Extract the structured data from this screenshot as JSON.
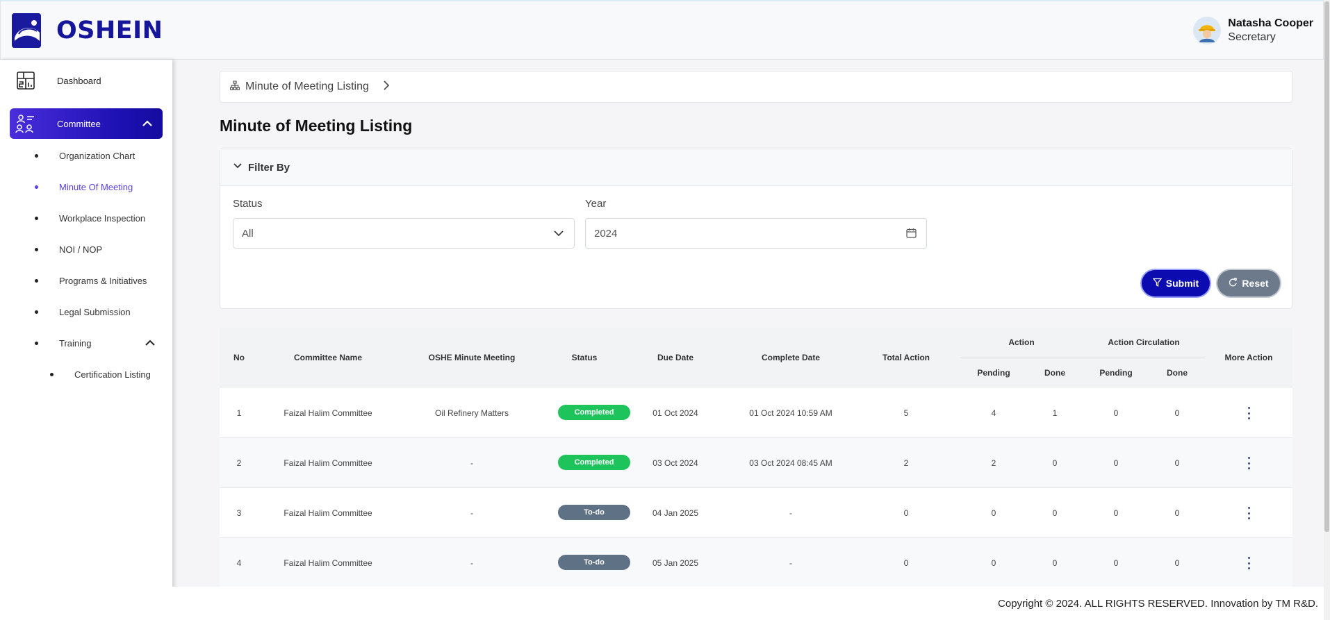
{
  "app": {
    "name": "OSHEIN"
  },
  "user": {
    "name": "Natasha Cooper",
    "role": "Secretary"
  },
  "sidebar": {
    "items": [
      {
        "label": "Dashboard",
        "icon": "dashboard-icon"
      },
      {
        "label": "Committee",
        "icon": "committee-icon",
        "active": true
      }
    ],
    "committee_sub": [
      {
        "label": "Organization Chart"
      },
      {
        "label": "Minute Of Meeting",
        "active": true
      },
      {
        "label": "Workplace Inspection"
      },
      {
        "label": "NOI / NOP"
      },
      {
        "label": "Programs & Initiatives"
      },
      {
        "label": "Legal Submission"
      },
      {
        "label": "Training"
      }
    ],
    "training_sub": [
      {
        "label": "Certification Listing"
      }
    ]
  },
  "breadcrumb": {
    "label": "Minute of Meeting Listing"
  },
  "page": {
    "title": "Minute of Meeting Listing"
  },
  "filter": {
    "title": "Filter By",
    "status_label": "Status",
    "status_value": "All",
    "year_label": "Year",
    "year_value": "2024",
    "submit_label": "Submit",
    "reset_label": "Reset"
  },
  "table": {
    "headers": {
      "no": "No",
      "committee": "Committee Name",
      "oshe": "OSHE Minute Meeting",
      "status": "Status",
      "due": "Due Date",
      "complete": "Complete Date",
      "total": "Total Action",
      "action_group": "Action",
      "action_circ_group": "Action Circulation",
      "pending": "Pending",
      "done": "Done",
      "more": "More Action"
    },
    "rows": [
      {
        "no": "1",
        "committee": "Faizal Halim Committee",
        "oshe": "Oil Refinery Matters",
        "status": "Completed",
        "due": "01 Oct 2024",
        "complete": "01 Oct 2024 10:59 AM",
        "total": "5",
        "pending": "4",
        "done": "1",
        "circ_pending": "0",
        "circ_done": "0"
      },
      {
        "no": "2",
        "committee": "Faizal Halim Committee",
        "oshe": "-",
        "status": "Completed",
        "due": "03 Oct 2024",
        "complete": "03 Oct 2024 08:45 AM",
        "total": "2",
        "pending": "2",
        "done": "0",
        "circ_pending": "0",
        "circ_done": "0"
      },
      {
        "no": "3",
        "committee": "Faizal Halim Committee",
        "oshe": "-",
        "status": "To-do",
        "due": "04 Jan 2025",
        "complete": "-",
        "total": "0",
        "pending": "0",
        "done": "0",
        "circ_pending": "0",
        "circ_done": "0"
      },
      {
        "no": "4",
        "committee": "Faizal Halim Committee",
        "oshe": "-",
        "status": "To-do",
        "due": "05 Jan 2025",
        "complete": "-",
        "total": "0",
        "pending": "0",
        "done": "0",
        "circ_pending": "0",
        "circ_done": "0"
      }
    ]
  },
  "footer": {
    "copyright": "Copyright © 2024. ALL RIGHTS RESERVED. Innovation by TM R&D."
  },
  "colors": {
    "brand": "#15169a",
    "active_nav": "#1e11b4",
    "completed": "#1fc35c",
    "todo": "#5e7185",
    "submit": "#0b0bb0"
  }
}
